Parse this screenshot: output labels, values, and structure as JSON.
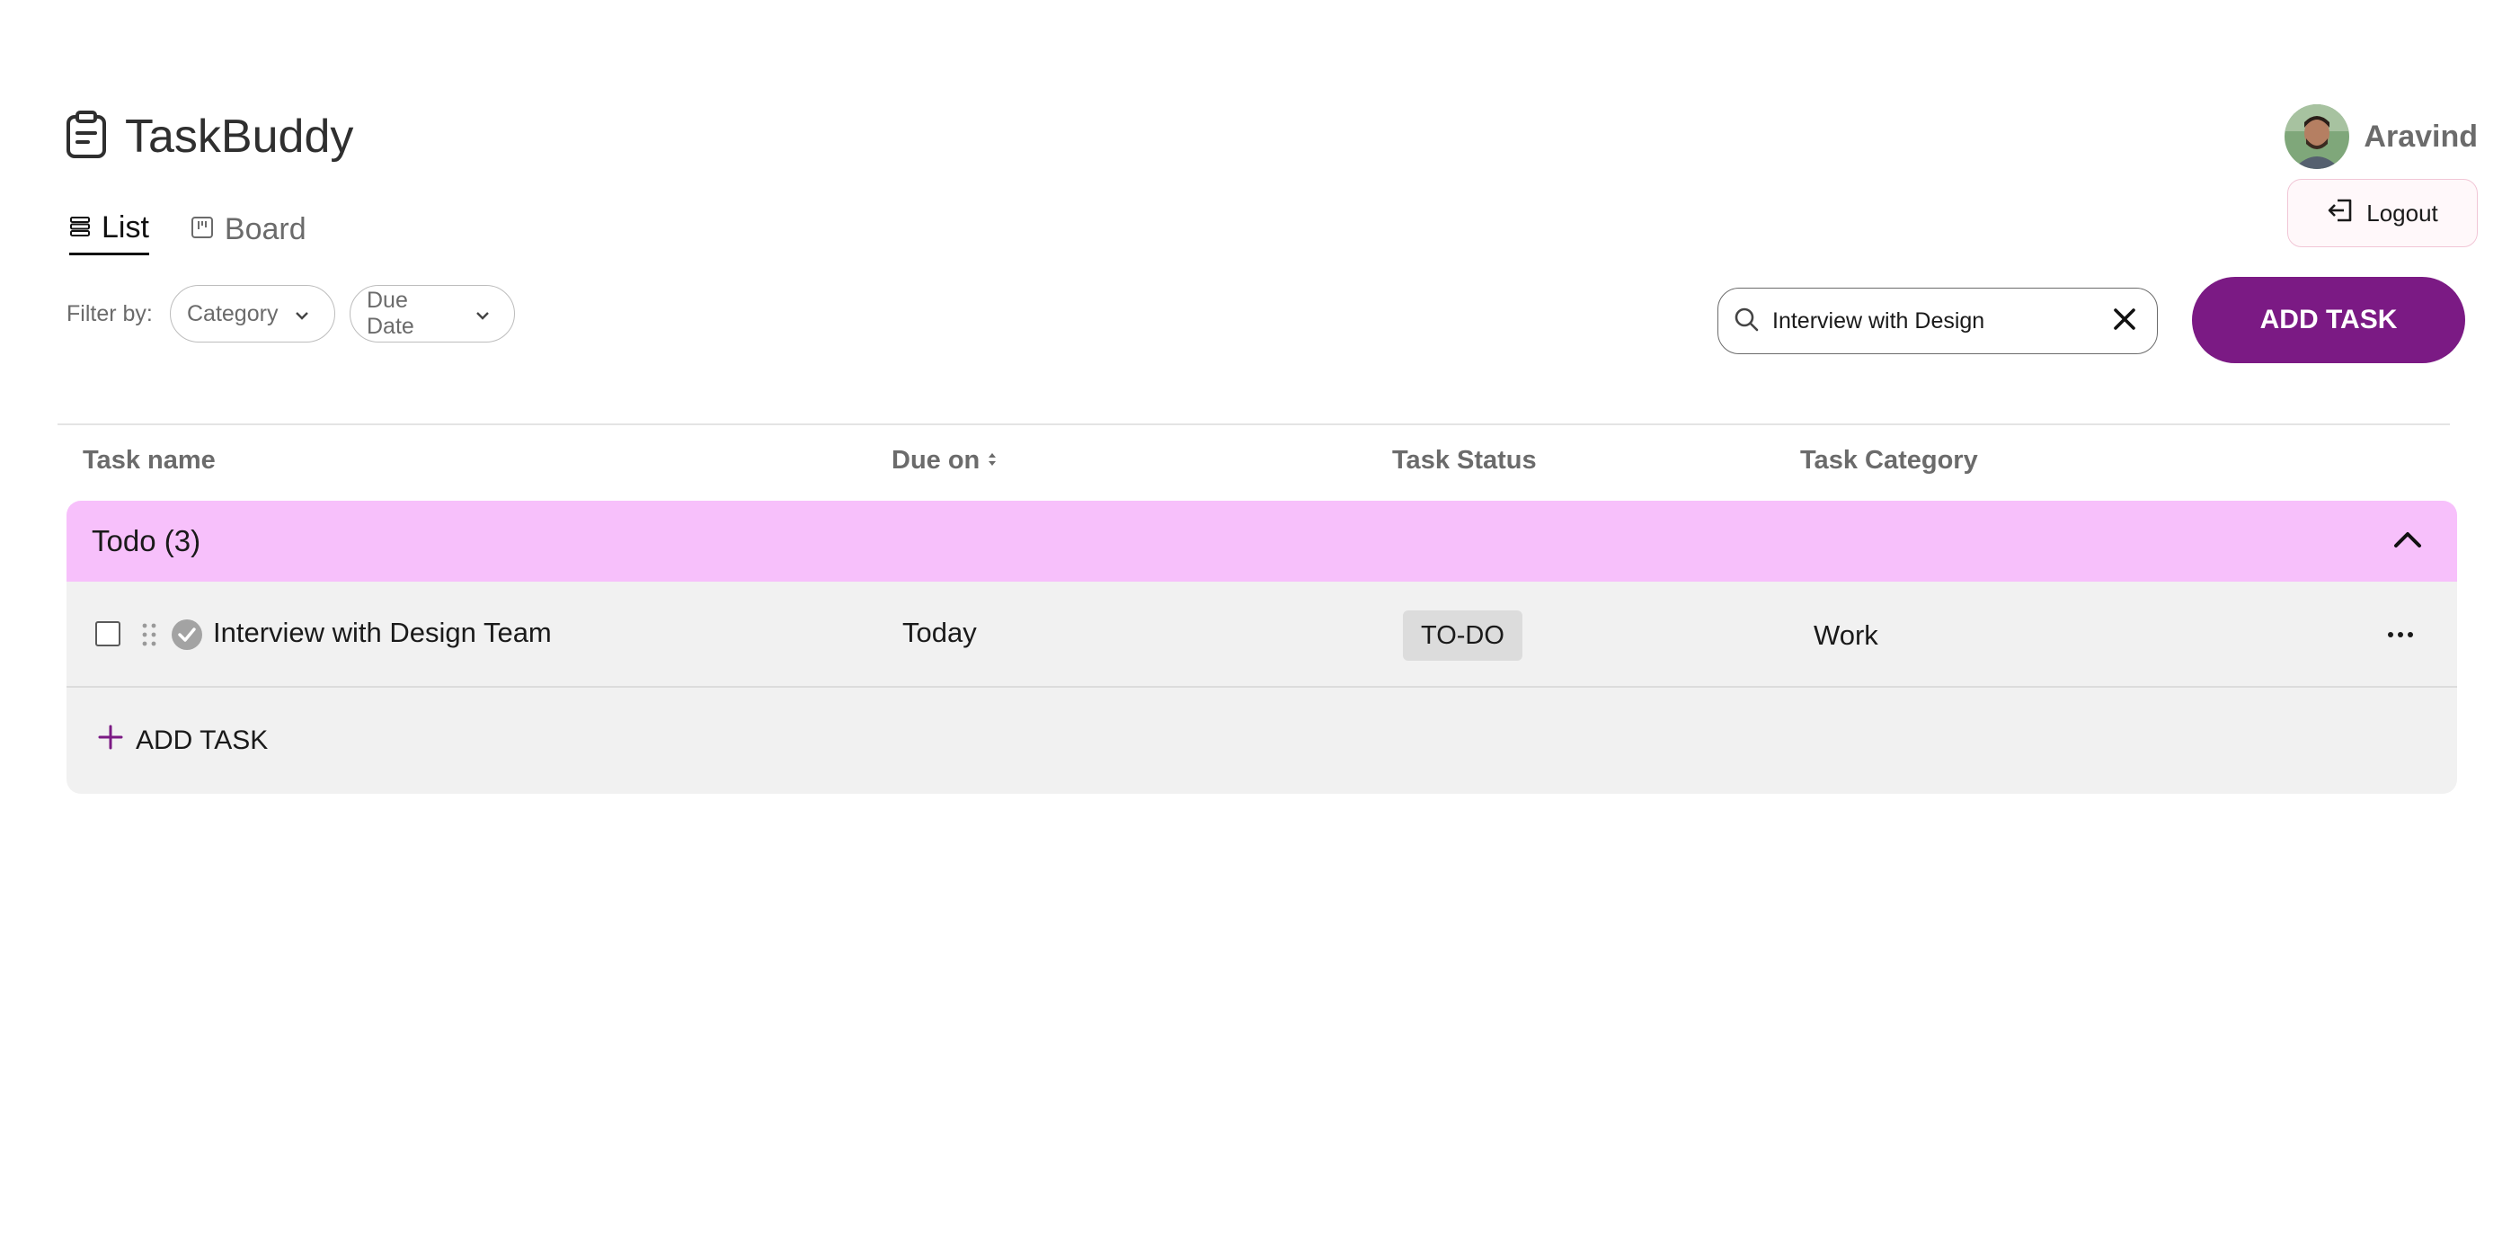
{
  "app": {
    "title": "TaskBuddy"
  },
  "user": {
    "name": "Aravind",
    "logout_label": "Logout"
  },
  "views": {
    "list_label": "List",
    "board_label": "Board",
    "active": "List"
  },
  "filters": {
    "label": "Filter by:",
    "category_label": "Category",
    "due_date_label": "Due Date"
  },
  "search": {
    "value": "Interview with Design"
  },
  "toolbar": {
    "add_task_label": "ADD TASK"
  },
  "table": {
    "columns": [
      "Task name",
      "Due on",
      "Task Status",
      "Task Category"
    ]
  },
  "groups": [
    {
      "title": "Todo (3)",
      "color": "#f7c0fb",
      "tasks": [
        {
          "name": "Interview with Design Team",
          "due": "Today",
          "status": "TO-DO",
          "category": "Work"
        }
      ],
      "add_task_label": "ADD TASK"
    }
  ],
  "colors": {
    "accent": "#7b1a84",
    "group_todo": "#f7c0fb"
  }
}
